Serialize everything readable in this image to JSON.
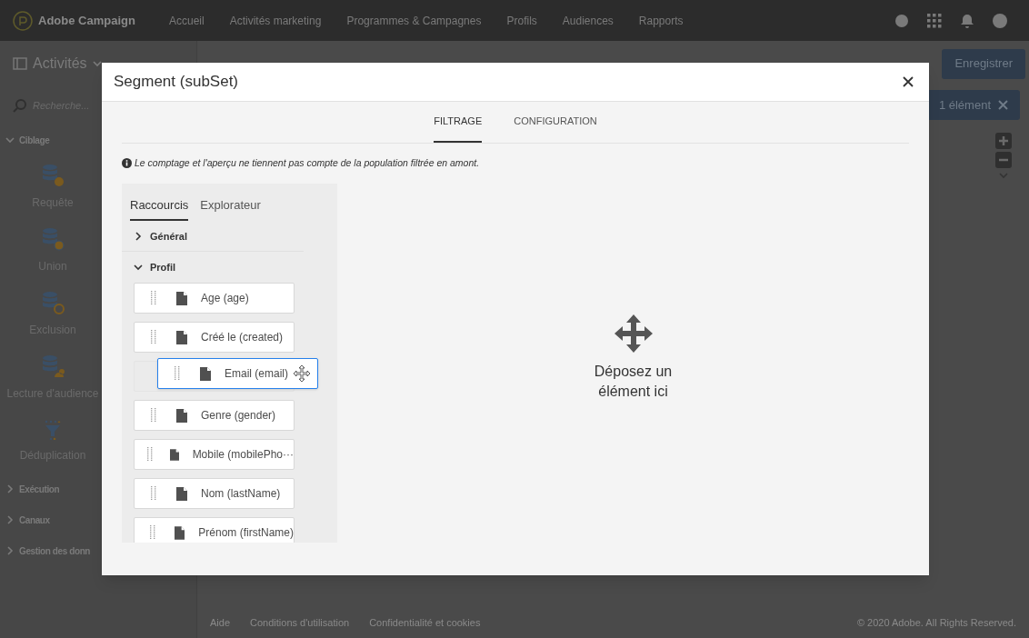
{
  "app_bar": {
    "brand": "Adobe Campaign",
    "nav": [
      {
        "label": "Accueil",
        "selected": false
      },
      {
        "label": "Activités marketing",
        "selected": false
      },
      {
        "label": "Programmes & Campagnes",
        "selected": false
      },
      {
        "label": "Profils",
        "selected": false
      },
      {
        "label": "Audiences",
        "selected": false
      },
      {
        "label": "Rapports",
        "selected": false
      }
    ]
  },
  "toolbar": {
    "title": "Activités",
    "save_button": "Enregistrer",
    "selection_chip": "1 élément"
  },
  "sidebar": {
    "search": {
      "placeholder": "Recherche..."
    },
    "groups": [
      {
        "label": "Ciblage",
        "expanded": true,
        "items": [
          {
            "label": "Requête",
            "kind": "query"
          },
          {
            "label": "Union",
            "kind": "union"
          },
          {
            "label": "Exclusion",
            "kind": "exclusion"
          },
          {
            "label": "Lecture d'audience",
            "kind": "audience"
          },
          {
            "label": "Déduplication",
            "kind": "dedup"
          }
        ]
      },
      {
        "label": "Exécution",
        "expanded": false
      },
      {
        "label": "Canaux",
        "expanded": false
      },
      {
        "label": "Gestion des donn",
        "expanded": false
      }
    ]
  },
  "footer": {
    "links": [
      "Aide",
      "Conditions d'utilisation",
      "Confidentialité et cookies"
    ],
    "copyright": "© 2020 Adobe. All Rights Reserved."
  },
  "dialog": {
    "title": "Segment (subSet)",
    "tabs": [
      {
        "label": "FILTRAGE",
        "selected": true
      },
      {
        "label": "CONFIGURATION",
        "selected": false
      }
    ],
    "note": "Le comptage et l'aperçu ne tiennent pas compte de la population filtrée en amont.",
    "panel_tabs": [
      {
        "label": "Raccourcis",
        "selected": true
      },
      {
        "label": "Explorateur",
        "selected": false
      }
    ],
    "sections": [
      {
        "label": "Général",
        "expanded": false
      },
      {
        "label": "Profil",
        "expanded": true,
        "fields": [
          {
            "label": "Age (age)",
            "dragging": false
          },
          {
            "label": "Créé le (created)",
            "dragging": false
          },
          {
            "label": "Email (email)",
            "dragging": true
          },
          {
            "label": "Genre (gender)",
            "dragging": false
          },
          {
            "label": "Mobile (mobilePho···",
            "dragging": false
          },
          {
            "label": "Nom (lastName)",
            "dragging": false
          },
          {
            "label": "Prénom (firstName)",
            "dragging": false
          }
        ]
      }
    ],
    "drop_zone": "Déposez un élément ici"
  }
}
